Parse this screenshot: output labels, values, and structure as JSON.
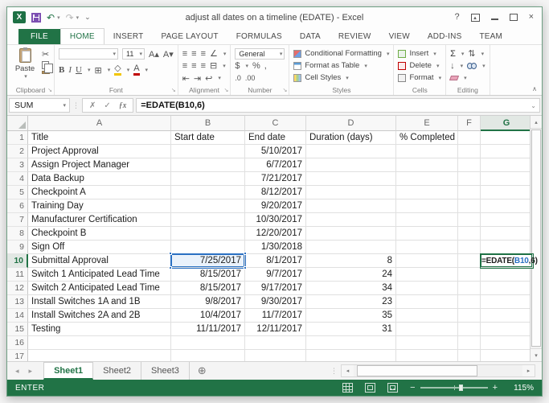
{
  "window": {
    "title": "adjust all dates on a timeline (EDATE) - Excel"
  },
  "colors": {
    "accent_green": "#217346",
    "reference_blue": "#2a70c2",
    "ref_cell_fill": "#eaf2fb"
  },
  "icons": {
    "excel_logo": "X",
    "undo": "↶",
    "redo": "↷",
    "qat_more": "⌄",
    "help": "?",
    "close": "×",
    "cancel": "✗",
    "enter": "✓",
    "fx": "ƒx",
    "dots": "⋮",
    "expand_formula_bar": "⌄",
    "cut": "✂",
    "dropdown": "▾",
    "launcher": "↘",
    "collapse_ribbon": "∧",
    "bold": "B",
    "italic": "I",
    "underline": "U",
    "borders": "⊞",
    "font_color": "A",
    "fill_color": "◇",
    "grow_font": "A▴",
    "shrink_font": "A▾",
    "align": "≡",
    "orientation": "∠",
    "indent_dec": "⇤",
    "indent_inc": "⇥",
    "wrap": "↩",
    "merge": "⊟",
    "dollar": "$",
    "percent": "%",
    "comma": ",",
    "inc_decimal": ".0",
    "dec_decimal": ".00",
    "autosum": "Σ",
    "sort": "⇅",
    "fill_down": "↓",
    "scroll_up": "▴",
    "scroll_down": "▾",
    "nav_left": "◂",
    "nav_right": "▸",
    "new_sheet": "⊕",
    "splitter": "⋮",
    "zoom_out": "−",
    "zoom_in": "+"
  },
  "ribbon": {
    "tabs": [
      {
        "label": "FILE",
        "file": true
      },
      {
        "label": "HOME",
        "active": true
      },
      {
        "label": "INSERT"
      },
      {
        "label": "PAGE LAYOUT"
      },
      {
        "label": "FORMULAS"
      },
      {
        "label": "DATA"
      },
      {
        "label": "REVIEW"
      },
      {
        "label": "VIEW"
      },
      {
        "label": "ADD-INS"
      },
      {
        "label": "TEAM"
      }
    ],
    "clipboard": {
      "label": "Clipboard",
      "paste": "Paste"
    },
    "font": {
      "label": "Font",
      "size": "11"
    },
    "alignment": {
      "label": "Alignment"
    },
    "number": {
      "label": "Number",
      "format": "General"
    },
    "styles": {
      "label": "Styles",
      "items": [
        "Conditional Formatting",
        "Format as Table",
        "Cell Styles"
      ]
    },
    "cells": {
      "label": "Cells",
      "items": [
        "Insert",
        "Delete",
        "Format"
      ]
    },
    "editing": {
      "label": "Editing"
    }
  },
  "formula_bar": {
    "name_box": "SUM",
    "prefix": "=EDATE(",
    "ref": "B10",
    "suffix": ",6)"
  },
  "grid": {
    "columns": [
      "A",
      "B",
      "C",
      "D",
      "E",
      "F",
      "G"
    ],
    "active_column": "G",
    "active_row": 10,
    "ref_cell": {
      "col": "b",
      "row": 10
    },
    "formula_cell": {
      "col": "g",
      "row": 10
    },
    "rows": [
      {
        "n": 1,
        "a": "Title",
        "b": "Start date",
        "c": "End date",
        "d": "Duration (days)",
        "e": "% Completed"
      },
      {
        "n": 2,
        "a": "Project Approval",
        "c": "5/10/2017"
      },
      {
        "n": 3,
        "a": "Assign Project Manager",
        "c": "6/7/2017"
      },
      {
        "n": 4,
        "a": "Data Backup",
        "c": "7/21/2017"
      },
      {
        "n": 5,
        "a": "Checkpoint A",
        "c": "8/12/2017"
      },
      {
        "n": 6,
        "a": "Training Day",
        "c": "9/20/2017"
      },
      {
        "n": 7,
        "a": "Manufacturer Certification",
        "c": "10/30/2017"
      },
      {
        "n": 8,
        "a": "Checkpoint B",
        "c": "12/20/2017"
      },
      {
        "n": 9,
        "a": "Sign Off",
        "c": "1/30/2018"
      },
      {
        "n": 10,
        "a": "Submittal Approval",
        "b": "7/25/2017",
        "c": "8/1/2017",
        "d": "8"
      },
      {
        "n": 11,
        "a": "Switch 1 Anticipated Lead Time",
        "b": "8/15/2017",
        "c": "9/7/2017",
        "d": "24"
      },
      {
        "n": 12,
        "a": "Switch 2 Anticipated Lead Time",
        "b": "8/15/2017",
        "c": "9/17/2017",
        "d": "34"
      },
      {
        "n": 13,
        "a": "Install Switches 1A and 1B",
        "b": "9/8/2017",
        "c": "9/30/2017",
        "d": "23"
      },
      {
        "n": 14,
        "a": "Install Switches 2A and 2B",
        "b": "10/4/2017",
        "c": "11/7/2017",
        "d": "35"
      },
      {
        "n": 15,
        "a": "Testing",
        "b": "11/11/2017",
        "c": "12/11/2017",
        "d": "31"
      },
      {
        "n": 16
      },
      {
        "n": 17
      }
    ]
  },
  "sheet_tabs": {
    "tabs": [
      {
        "label": "Sheet1",
        "active": true
      },
      {
        "label": "Sheet2"
      },
      {
        "label": "Sheet3"
      }
    ]
  },
  "status_bar": {
    "mode": "ENTER",
    "zoom": "115%"
  }
}
